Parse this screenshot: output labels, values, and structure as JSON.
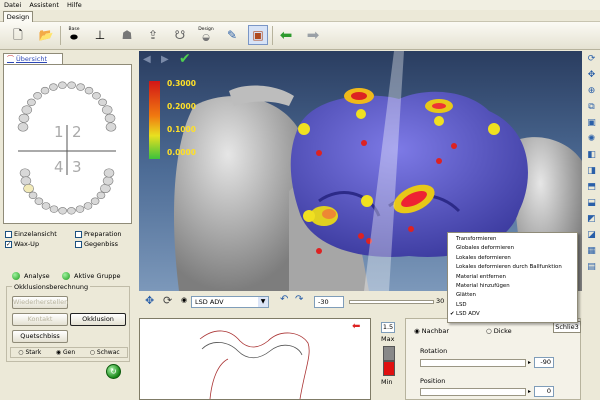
{
  "menu": [
    "Datei",
    "Assistent",
    "Hilfe"
  ],
  "design_tab": "Design",
  "toolbar": {
    "buttons": [
      {
        "name": "new-icon",
        "label": ""
      },
      {
        "name": "open-icon",
        "label": ""
      },
      {
        "name": "base-icon",
        "label": "Base"
      },
      {
        "name": "axis-icon",
        "label": ""
      },
      {
        "name": "model-icon",
        "label": ""
      },
      {
        "name": "upload-icon",
        "label": ""
      },
      {
        "name": "tooth-icon",
        "label": ""
      },
      {
        "name": "design-icon",
        "label": "Design"
      },
      {
        "name": "paint-icon",
        "label": ""
      },
      {
        "name": "export-icon",
        "label": ""
      }
    ]
  },
  "overview_tab": "Übersicht",
  "quadrants": [
    "1",
    "2",
    "4",
    "3"
  ],
  "checkboxes": [
    {
      "label": "Einzelansicht",
      "checked": false
    },
    {
      "label": "Preparation",
      "checked": false
    },
    {
      "label": "Wax-Up",
      "checked": true
    },
    {
      "label": "Gegenbiss",
      "checked": false
    }
  ],
  "status": {
    "analyse": "Analyse",
    "aktive_gruppe": "Aktive Gruppe"
  },
  "occlusion": {
    "group_title": "Okklusionsberechnung",
    "wiederherstellen": "Wiederherstellen",
    "kontakt": "Kontakt",
    "okklusion": "Okklusion",
    "quetschbiss": "Quetschbiss",
    "radios": [
      "Stark",
      "Gen",
      "Schwac"
    ],
    "selected_radio": "Gen"
  },
  "legend": [
    "0.3000",
    "0.2000",
    "0.1000",
    "0.0000"
  ],
  "view_controls": {
    "tool_select": "LSD ADV",
    "value_left": "-30",
    "value_right": "30"
  },
  "context_menu": {
    "items": [
      "Transformieren",
      "Globales deformieren",
      "Lokales deformieren",
      "Lokales deformieren durch Ballfunktion",
      "Material entfernen",
      "Material hinzufügen",
      "Glätten",
      "LSD",
      "LSD ADV"
    ],
    "checked": "LSD ADV"
  },
  "side_panel": {
    "tab_label": "Schlie3",
    "radio_a": "Nachbar",
    "radio_b": "Dicke",
    "rotation_label": "Rotation",
    "rotation_value": "-90",
    "position_label": "Position",
    "position_value": "0"
  },
  "intensity": {
    "value": "1.5",
    "max_label": "Max",
    "min_label": "Min"
  },
  "colors": {
    "accent": "#2c47b5",
    "legend_text": "#ffe028",
    "tooth_blue": "#5a57c9"
  }
}
